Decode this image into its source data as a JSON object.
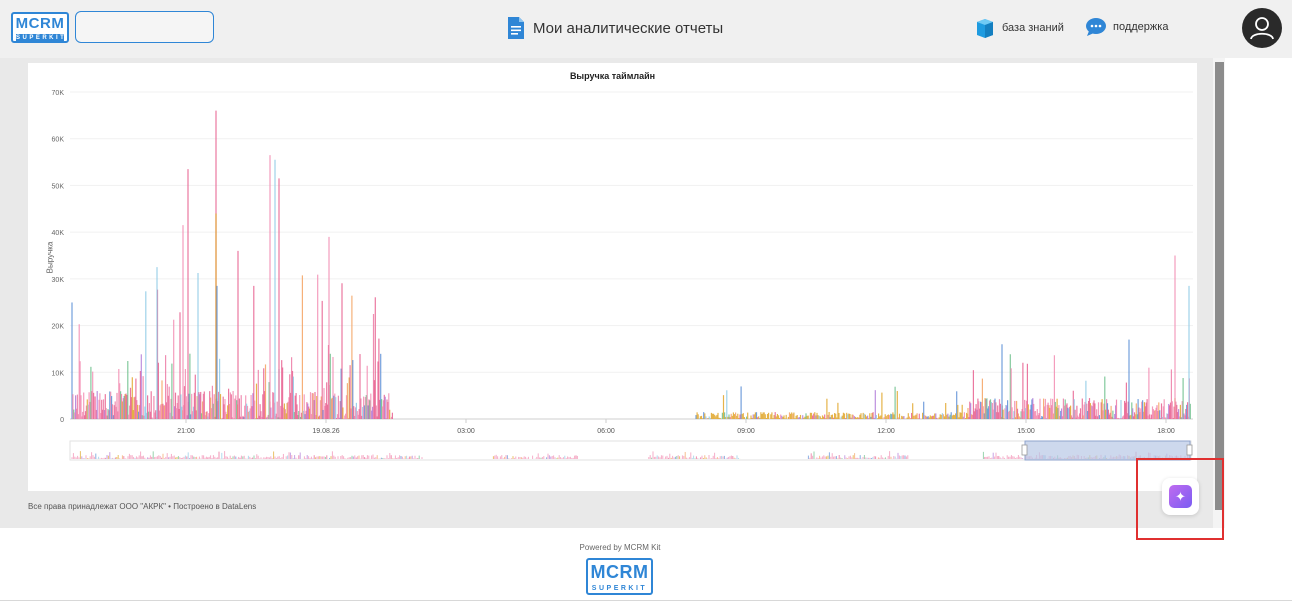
{
  "header": {
    "logo_main": "MCRM",
    "logo_sub": "SUPERKIT",
    "title": "Мои аналитические отчеты",
    "title_icon": "document-icon",
    "links": [
      {
        "label": "база знаний",
        "icon": "cube-icon"
      },
      {
        "label": "поддержка",
        "icon": "chat-bubble-icon"
      }
    ],
    "avatar_icon": "user-icon"
  },
  "chart_data": {
    "type": "bar",
    "title": "Выручка таймлайн",
    "ylabel": "Выручка",
    "xlabel": "",
    "yticks": [
      "0",
      "10K",
      "20K",
      "30K",
      "40K",
      "50K",
      "60K",
      "70K"
    ],
    "ylim": [
      0,
      70000
    ],
    "xticks": [
      "21:00",
      "19.08.26",
      "03:00",
      "06:00",
      "09:00",
      "12:00",
      "15:00",
      "18:00"
    ],
    "series_colors": [
      "#e8608f",
      "#f28cb1",
      "#5b8ed6",
      "#8ecae6",
      "#e0a62a",
      "#6cc08b",
      "#b07ad8",
      "#f4a261"
    ],
    "notable_peaks": [
      {
        "x": "~22:05",
        "value": 66000
      },
      {
        "x": "~22:35",
        "value": 56500
      },
      {
        "x": "~23:10",
        "value": 55500
      },
      {
        "x": "~21:00",
        "value": 53500
      },
      {
        "x": "~22:05",
        "value": 44000
      },
      {
        "x": "~21:00",
        "value": 41500
      },
      {
        "x": "~00:00",
        "value": 39000
      },
      {
        "x": "~18:10",
        "value": 35000
      },
      {
        "x": "~20:25",
        "value": 32500
      },
      {
        "x": "~18:30",
        "value": 28500
      }
    ],
    "grid": "horizontal",
    "legend": "none",
    "navigator": true
  },
  "footer": {
    "copyright": "Все права принадлежат ООО \"АКРК\" • Построено в DataLens",
    "powered_by": "Powered by MCRM Kit",
    "logo_main": "MCRM",
    "logo_sub": "SUPERKIT"
  },
  "ai_button": {
    "icon": "sparkle-icon"
  }
}
